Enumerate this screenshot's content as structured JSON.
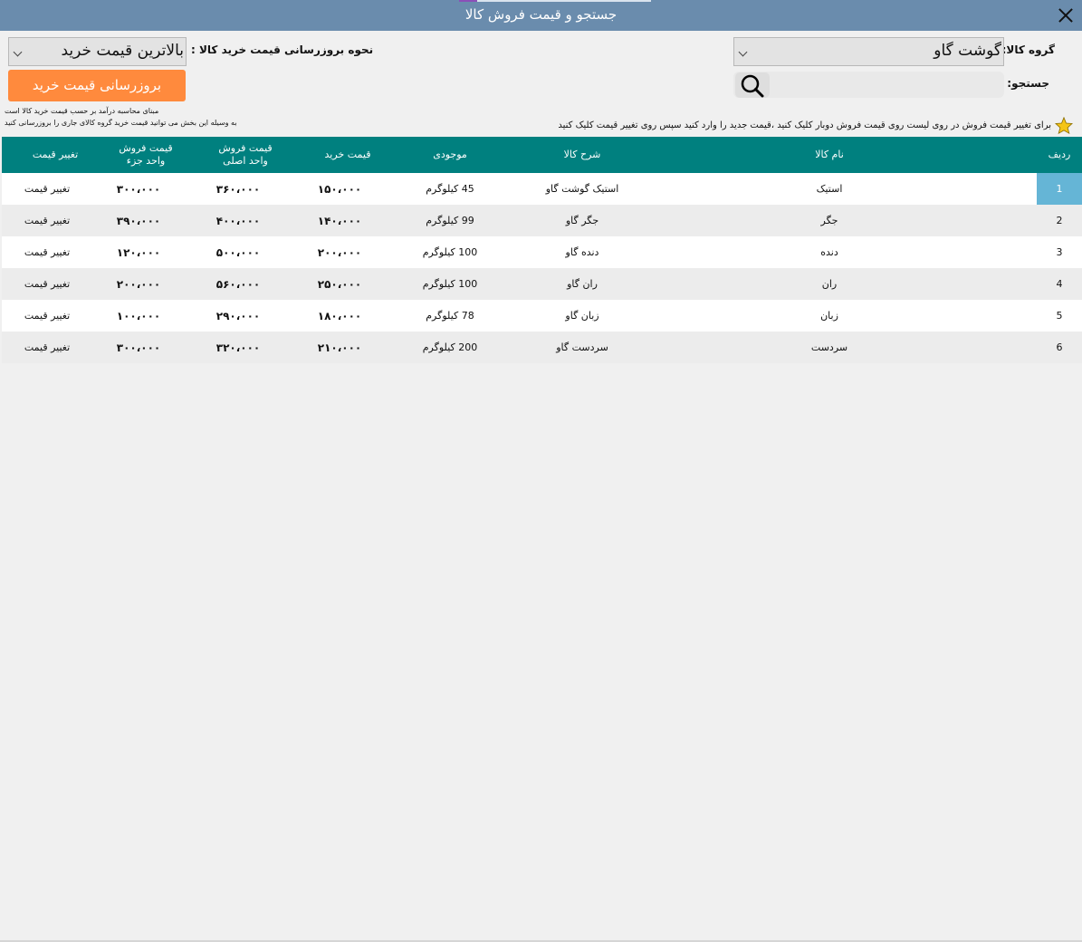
{
  "window": {
    "title": "جستجو و قیمت فروش کالا"
  },
  "filters": {
    "group_label": "گروه کالا:",
    "group_value": "گوشت گاو",
    "search_label": "جستجو:",
    "search_value": "",
    "search_placeholder": ""
  },
  "update": {
    "method_label": "نحوه بروزرسانی قیمت خرید کالا :",
    "method_value": "بالاترین قیمت خرید",
    "button_label": "بروزرسانی قیمت خرید",
    "note_line1": "مبنای محاسبه درآمد بر حسب قیمت خرید کالا است",
    "note_line2": "به وسیله این بخش می توانید قیمت خرید گروه کالای جاری را بروزرسانی کنید"
  },
  "hint": {
    "icon": "star-icon",
    "text": "برای تغییر قیمت فروش در روی لیست روی قیمت فروش دوبار کلیک کنید ،قیمت جدید را وارد کنید سپس روی تغییر قیمت کلیک کنید"
  },
  "table": {
    "headers": {
      "row": "ردیف",
      "name": "نام کالا",
      "desc": "شرح کالا",
      "stock": "موجودی",
      "buy": "قیمت خرید",
      "sell_main_1": "قیمت فروش",
      "sell_main_2": "واحد اصلی",
      "sell_part_1": "قیمت فروش",
      "sell_part_2": "واحد جزء",
      "change": "تغییر قیمت"
    },
    "rows": [
      {
        "row": "1",
        "name": "استیک",
        "desc": "استیک گوشت گاو",
        "stock": "45 کیلوگرم",
        "buy": "۱۵۰،۰۰۰",
        "sell_main": "۳۶۰،۰۰۰",
        "sell_part": "۳۰۰،۰۰۰",
        "change": "تغییر قیمت"
      },
      {
        "row": "2",
        "name": "جگر",
        "desc": "جگر گاو",
        "stock": "99 کیلوگرم",
        "buy": "۱۴۰،۰۰۰",
        "sell_main": "۴۰۰،۰۰۰",
        "sell_part": "۳۹۰،۰۰۰",
        "change": "تغییر قیمت"
      },
      {
        "row": "3",
        "name": "دنده",
        "desc": "دنده گاو",
        "stock": "100 کیلوگرم",
        "buy": "۲۰۰،۰۰۰",
        "sell_main": "۵۰۰،۰۰۰",
        "sell_part": "۱۲۰،۰۰۰",
        "change": "تغییر قیمت"
      },
      {
        "row": "4",
        "name": "ران",
        "desc": "ران گاو",
        "stock": "100 کیلوگرم",
        "buy": "۲۵۰،۰۰۰",
        "sell_main": "۵۶۰،۰۰۰",
        "sell_part": "۲۰۰،۰۰۰",
        "change": "تغییر قیمت"
      },
      {
        "row": "5",
        "name": "زبان",
        "desc": "زبان گاو",
        "stock": "78 کیلوگرم",
        "buy": "۱۸۰،۰۰۰",
        "sell_main": "۲۹۰،۰۰۰",
        "sell_part": "۱۰۰،۰۰۰",
        "change": "تغییر قیمت"
      },
      {
        "row": "6",
        "name": "سردست",
        "desc": "سردست گاو",
        "stock": "200 کیلوگرم",
        "buy": "۲۱۰،۰۰۰",
        "sell_main": "۳۲۰،۰۰۰",
        "sell_part": "۳۰۰،۰۰۰",
        "change": "تغییر قیمت"
      }
    ],
    "selected_row": 0
  },
  "colors": {
    "titlebar": "#6a8cad",
    "header": "#00807f",
    "button": "#ff8a3d",
    "selected": "#65b5d6",
    "star": "#f5c518"
  }
}
